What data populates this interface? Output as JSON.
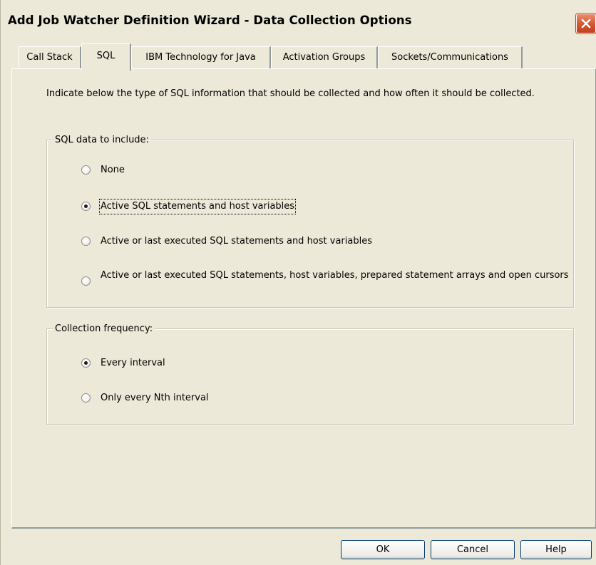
{
  "window": {
    "title": "Add Job Watcher Definition Wizard - Data Collection Options",
    "close_icon": "close-x"
  },
  "tabs": [
    {
      "label": "Call Stack",
      "active": false
    },
    {
      "label": "SQL",
      "active": true
    },
    {
      "label": "IBM Technology for Java",
      "active": false
    },
    {
      "label": "Activation Groups",
      "active": false
    },
    {
      "label": "Sockets/Communications",
      "active": false
    }
  ],
  "intro_text": "Indicate below the type of SQL information that should be collected and how often it should be collected.",
  "sql_group": {
    "legend": "SQL data to include:",
    "options": [
      {
        "label": "None",
        "checked": false
      },
      {
        "label": "Active SQL statements and host variables",
        "checked": true
      },
      {
        "label": "Active or last executed SQL statements and host variables",
        "checked": false
      },
      {
        "label": "Active or last executed SQL statements, host variables, prepared statement arrays and open cursors",
        "checked": false
      }
    ]
  },
  "frequency_group": {
    "legend": "Collection frequency:",
    "options": [
      {
        "label": "Every interval",
        "checked": true
      },
      {
        "label": "Only every Nth interval",
        "checked": false
      }
    ]
  },
  "buttons": {
    "ok": "OK",
    "cancel": "Cancel",
    "help": "Help"
  },
  "colors": {
    "dialog_bg": "#ece9d8",
    "close_button": "#d25630",
    "tab_border": "#919b9c"
  }
}
